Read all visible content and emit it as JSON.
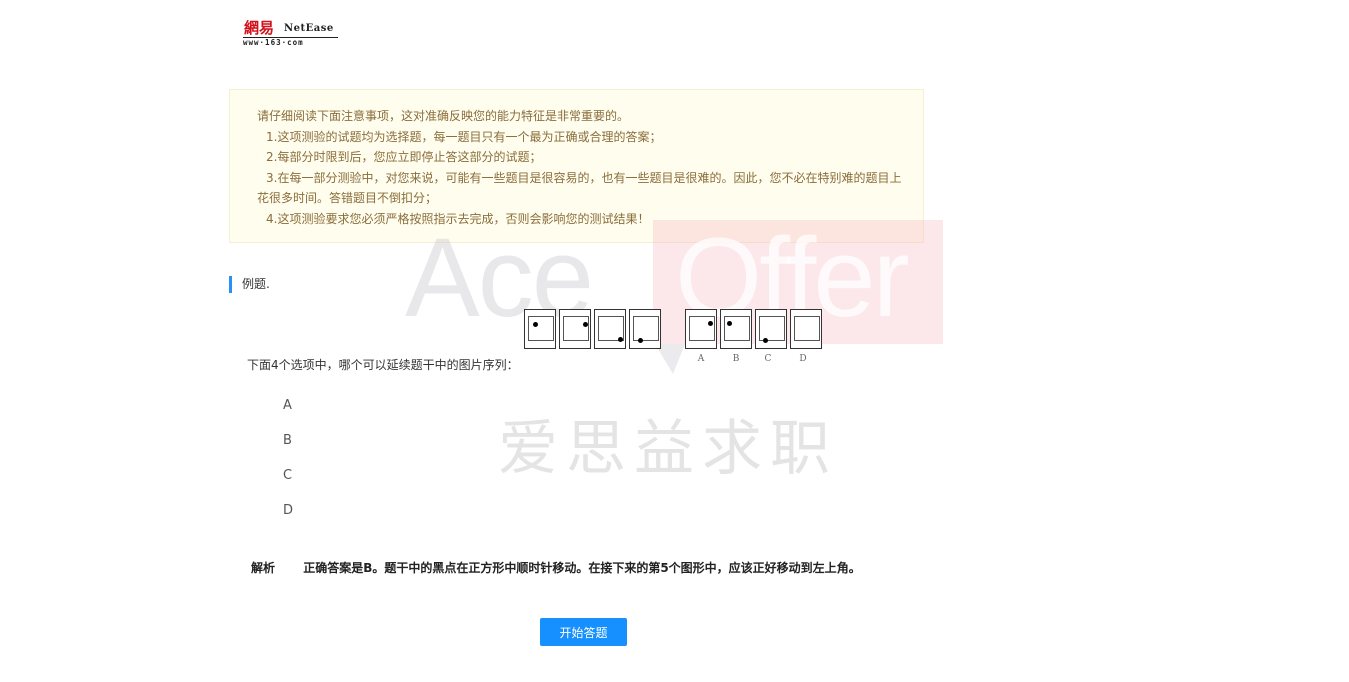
{
  "logo": {
    "cn": "網易",
    "en": "NetEase",
    "url": "www·163·com"
  },
  "notice": {
    "intro": "请仔细阅读下面注意事项，这对准确反映您的能力特征是非常重要的。",
    "item1": "1.这项测验的试题均为选择题，每一题目只有一个最为正确或合理的答案；",
    "item2": "2.每部分时限到后，您应立即停止答这部分的试题；",
    "item3a": "3.在每一部分测验中，对您来说，可能有一些题目是很容易的，也有一些题目是很难的。因此，您不必在特别难的题目上",
    "item3b": "花很多时间。答错题目不倒扣分；",
    "item4": "4.这项测验要求您必须严格按照指示去完成，否则会影响您的测试结果！"
  },
  "watermark": {
    "ace": "Ace",
    "offer": "Offer",
    "cn": "爱思益求职"
  },
  "example": {
    "title": "例题.",
    "question": "下面4个选项中，哪个可以延续题干中的图片序列：",
    "figure_labels": [
      "A",
      "B",
      "C",
      "D"
    ]
  },
  "options": [
    "A",
    "B",
    "C",
    "D"
  ],
  "analysis": {
    "label": "解析",
    "text": "正确答案是B。题干中的黑点在正方形中顺时针移动。在接下来的第5个图形中，应该正好移动到左上角。"
  },
  "start_button": "开始答题"
}
